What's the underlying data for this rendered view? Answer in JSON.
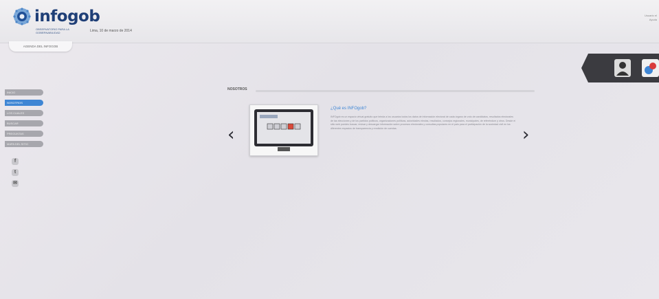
{
  "header": {
    "logo_text": "infogob",
    "tagline": "OBSERVATORIO PARA LA GOBERNABILIDAD",
    "date": "Lima, 10 de marzo de 2014",
    "agenda_tab": "AGENDA DEL INFOGOB",
    "top_right": "Usuario el Ayuda"
  },
  "sidebar": {
    "items": [
      {
        "label": "INICIO",
        "active": false
      },
      {
        "label": "NOSOTROS",
        "active": true
      },
      {
        "label": "LOS CUALES",
        "active": false
      },
      {
        "label": "BUSCAR",
        "active": false
      },
      {
        "label": "PREGUNTAS",
        "active": false
      },
      {
        "label": "MAPA DEL SITIO",
        "active": false
      }
    ],
    "social": [
      {
        "name": "facebook-icon",
        "glyph": "f"
      },
      {
        "name": "twitter-icon",
        "glyph": "t"
      },
      {
        "name": "email-icon",
        "glyph": "✉"
      }
    ]
  },
  "content": {
    "section_label": "NOSOTROS",
    "question_title": "¿Qué es INFOgob?",
    "question_text": "INFOgob es un espacio virtual gratuito que brinda a los usuarios todos los datos de información electoral de cada órgano de voto de candidatos, resultados electorales de las elecciones y de los partidos políticos, organizaciones políticas, autoridades electas, resultados, consejos regionales, municipales, de referéndum y otros. Desde el sitio web puedes buscar, revisar y descargar información sobre procesos electorales y consultas populares en el país para el participación de la sociedad civil en los diferentes espacios de transparencia y rendición de cuentas.",
    "prev_arrow": "‹",
    "next_arrow": "›"
  },
  "colors": {
    "accent": "#3f86d4",
    "brand": "#1f3f77"
  }
}
